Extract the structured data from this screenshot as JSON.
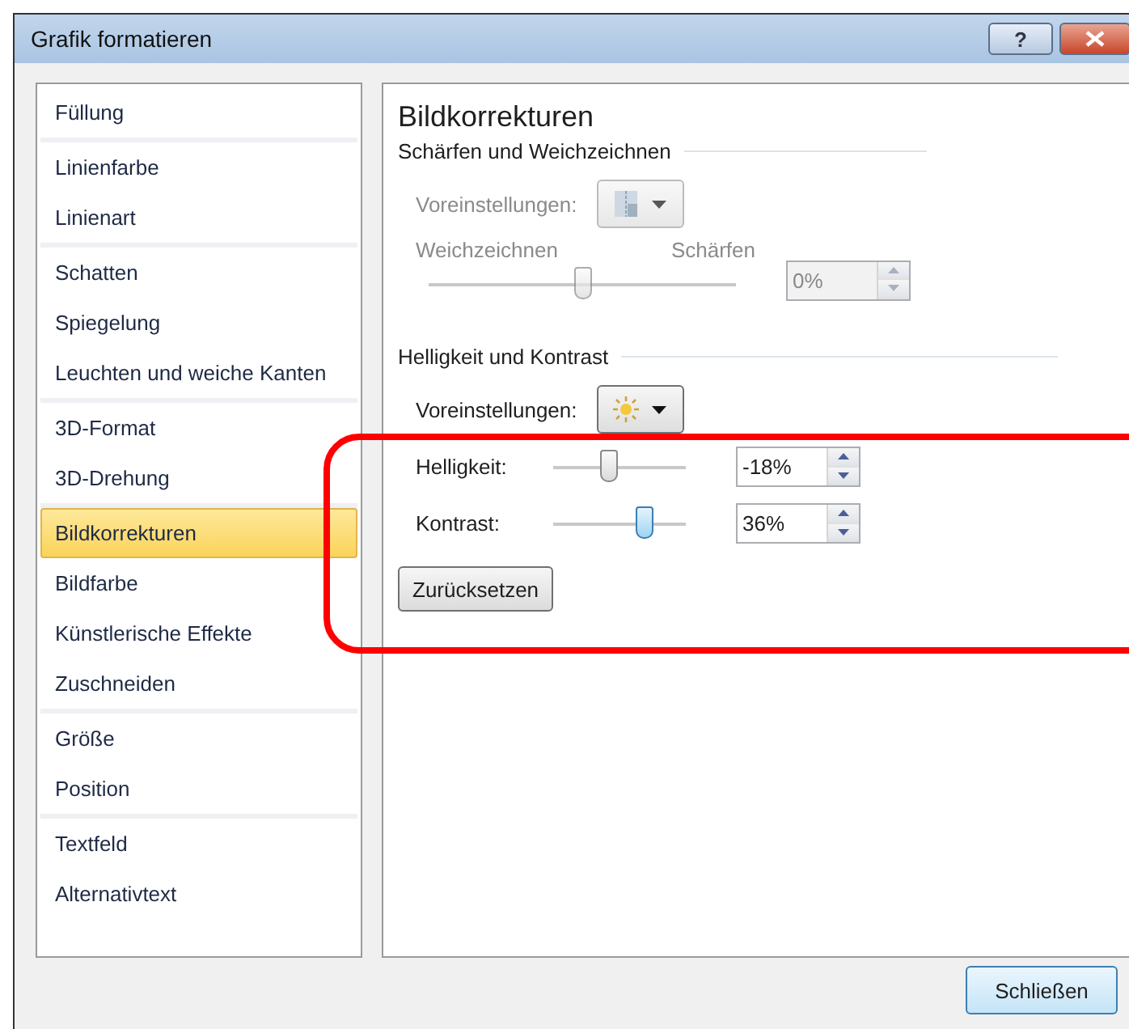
{
  "window": {
    "title": "Grafik formatieren",
    "help_button": "?"
  },
  "sidebar": {
    "groups": [
      {
        "items": [
          {
            "label": "Füllung",
            "selected": false
          }
        ]
      },
      {
        "items": [
          {
            "label": "Linienfarbe",
            "selected": false
          },
          {
            "label": "Linienart",
            "selected": false
          }
        ]
      },
      {
        "items": [
          {
            "label": "Schatten",
            "selected": false
          },
          {
            "label": "Spiegelung",
            "selected": false
          },
          {
            "label": "Leuchten und weiche Kanten",
            "selected": false
          }
        ]
      },
      {
        "items": [
          {
            "label": "3D-Format",
            "selected": false
          },
          {
            "label": "3D-Drehung",
            "selected": false
          }
        ]
      },
      {
        "items": [
          {
            "label": "Bildkorrekturen",
            "selected": true
          },
          {
            "label": "Bildfarbe",
            "selected": false
          },
          {
            "label": "Künstlerische Effekte",
            "selected": false
          },
          {
            "label": "Zuschneiden",
            "selected": false
          }
        ]
      },
      {
        "items": [
          {
            "label": "Größe",
            "selected": false
          },
          {
            "label": "Position",
            "selected": false
          }
        ]
      },
      {
        "items": [
          {
            "label": "Textfeld",
            "selected": false
          },
          {
            "label": "Alternativtext",
            "selected": false
          }
        ]
      }
    ]
  },
  "panel": {
    "title": "Bildkorrekturen",
    "sharpen": {
      "heading": "Schärfen und Weichzeichnen",
      "presets_label": "Voreinstellungen:",
      "disabled": true,
      "left_label": "Weichzeichnen",
      "right_label": "Schärfen",
      "level": 0.5,
      "value": "0%"
    },
    "brightness_contrast": {
      "heading": "Helligkeit und Kontrast",
      "presets_label": "Voreinstellungen:",
      "rows": [
        {
          "label": "Helligkeit:",
          "level": 0.41,
          "value": "-18%",
          "focused": false
        },
        {
          "label": "Kontrast:",
          "level": 0.68,
          "value": "36%",
          "focused": true
        }
      ],
      "reset_button": "Zurücksetzen"
    }
  },
  "buttons": [
    "Schließen"
  ]
}
